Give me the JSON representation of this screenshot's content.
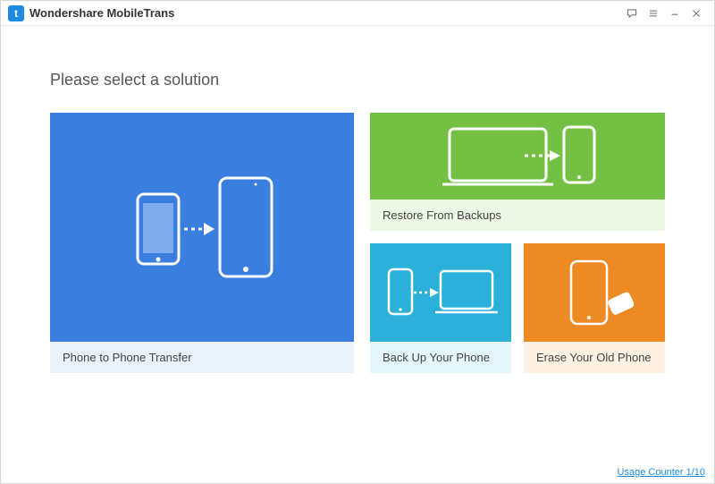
{
  "app": {
    "title": "Wondershare MobileTrans"
  },
  "heading": "Please select a solution",
  "cards": {
    "transfer": {
      "label": "Phone to Phone Transfer"
    },
    "restore": {
      "label": "Restore From Backups"
    },
    "backup": {
      "label": "Back Up Your Phone"
    },
    "erase": {
      "label": "Erase Your Old Phone"
    }
  },
  "footer": {
    "usage_counter": "Usage Counter 1/10"
  },
  "colors": {
    "transfer": "#3a7fe0",
    "restore": "#74c044",
    "backup": "#2bb1d9",
    "erase": "#ee8a24"
  }
}
